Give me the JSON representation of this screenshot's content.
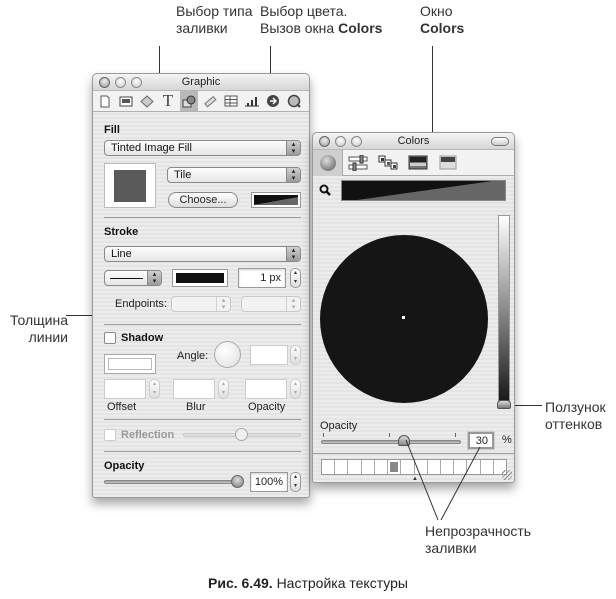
{
  "callouts": {
    "fill_type": [
      "Выбор типа",
      "заливки"
    ],
    "color_choice_line1": "Выбор цвета.",
    "color_choice_line2_prefix": "Вызов окна ",
    "color_choice_line2_bold": "Colors",
    "colors_window_line1": "Окно",
    "colors_window_line2": "Colors",
    "line_width": [
      "Толщина",
      "линии"
    ],
    "shade_slider": [
      "Ползунок",
      "оттенков"
    ],
    "fill_opacity": [
      "Непрозрачность",
      "заливки"
    ]
  },
  "caption": {
    "number": "Рис. 6.49.",
    "text": "Настройка текстуры"
  },
  "graphic_window": {
    "title": "Graphic",
    "toolbar_icons": [
      "document-icon",
      "layout-icon",
      "wrap-icon",
      "text-icon",
      "graphic-icon",
      "metrics-icon",
      "table-icon",
      "chart-icon",
      "link-icon",
      "quicktime-icon"
    ],
    "active_tab": "graphic-icon",
    "fill": {
      "label": "Fill",
      "type": "Tinted Image Fill",
      "scale": "Tile",
      "choose_button": "Choose...",
      "image_tint_color": "#5a5a5a"
    },
    "stroke": {
      "label": "Stroke",
      "type": "Line",
      "color": "#111111",
      "width": "1 px",
      "endpoints_label": "Endpoints:"
    },
    "shadow": {
      "label": "Shadow",
      "checked": false,
      "angle_label": "Angle:",
      "offset_label": "Offset",
      "blur_label": "Blur",
      "opacity_label": "Opacity"
    },
    "reflection": {
      "label": "Reflection",
      "checked": false,
      "enabled": false
    },
    "opacity": {
      "label": "Opacity",
      "value": "100%",
      "fraction": 1.0
    }
  },
  "colors_window": {
    "title": "Colors",
    "modes": [
      "color-wheel-icon",
      "color-sliders-icon",
      "color-palettes-icon",
      "image-palettes-icon",
      "crayons-icon"
    ],
    "active_mode": "color-wheel-icon",
    "selected_color": "#111111",
    "opacity_label": "Opacity",
    "opacity_value": "30",
    "opacity_unit": "%",
    "opacity_fraction": 0.3,
    "brightness_fraction": 0.0,
    "swatch_count": 14,
    "selected_swatch_index": 5
  }
}
